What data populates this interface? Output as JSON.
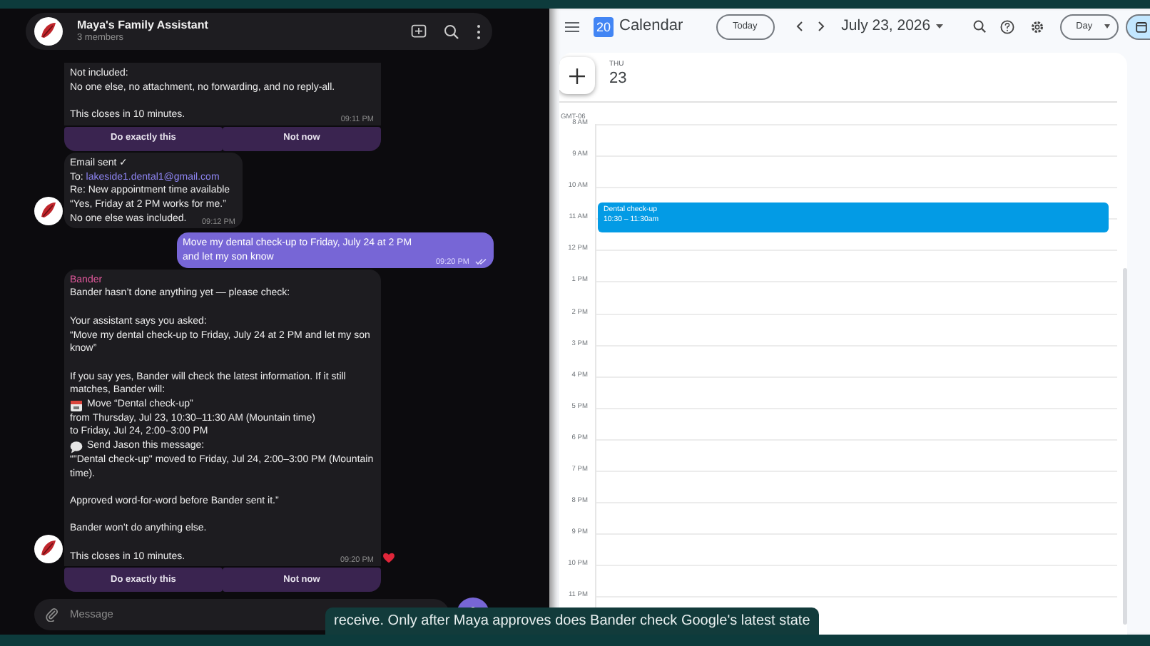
{
  "chat": {
    "title": "Maya's Family Assistant",
    "subtitle": "3 members",
    "messages": [
      {
        "kind": "bot",
        "avatar": false,
        "paragraphs": [
          [
            {
              "text": "Not included:"
            },
            {
              "text": "No one else, no attachment, no forwarding, and no reply-all."
            }
          ],
          [
            {
              "text": "This closes in 10 minutes."
            }
          ]
        ],
        "time": "09:11 PM",
        "buttons": [
          "Do exactly this",
          "Not now"
        ]
      },
      {
        "kind": "bot",
        "avatar": true,
        "paragraphs": [
          [
            {
              "text": "Email sent ✓"
            },
            {
              "text": "To:",
              "link": "lakeside1.dental1@gmail.com"
            },
            {
              "text": "Re: New appointment time available"
            },
            {
              "text": "“Yes, Friday at 2 PM works for me.”"
            },
            {
              "text": "No one else was included."
            }
          ]
        ],
        "time": "09:12 PM"
      },
      {
        "kind": "user",
        "paragraphs": [
          [
            {
              "text": "Move my dental check-up to Friday, July 24 at 2 PM and let my son know"
            }
          ]
        ],
        "time": "09:20 PM",
        "read": true
      },
      {
        "kind": "bot",
        "avatar": true,
        "sender": "Bander",
        "paragraphs": [
          [
            {
              "text": "Bander hasn’t done anything yet — please check:"
            }
          ],
          [
            {
              "text": "Your assistant says you asked:"
            },
            {
              "text": "“Move my dental check-up to Friday, July 24 at 2 PM and let my son know”"
            }
          ],
          [
            {
              "text": "If you say yes, Bander will check the latest information. If it still matches, Bander will:"
            },
            {
              "text": "Move “Dental check-up”",
              "kind": "calendar_item"
            },
            {
              "text": "from Thursday, Jul 23, 10:30–11:30 AM (Mountain time)"
            },
            {
              "text": "to Friday, Jul 24, 2:00–3:00 PM"
            },
            {
              "text": "Send Jason this message:",
              "kind": "message_item"
            },
            {
              "text": "“\"Dental check-up\" moved to Friday, Jul 24, 2:00–3:00 PM (Mountain time)."
            }
          ],
          [
            {
              "text": "Approved word-for-word before Bander sent it.”"
            }
          ],
          [
            {
              "text": "Bander won’t do anything else."
            }
          ],
          [
            {
              "text": "This closes in 10 minutes."
            }
          ]
        ],
        "time": "09:20 PM",
        "reacted": true,
        "buttons": [
          "Do exactly this",
          "Not now"
        ]
      }
    ],
    "input": {
      "placeholder": "Message"
    }
  },
  "calendar": {
    "logo_day": "20",
    "title": "Calendar",
    "today_button": "Today",
    "date": "July 23, 2026",
    "view": "Day",
    "day": {
      "name": "THU",
      "number": "23"
    },
    "timezone": "GMT-06",
    "hours": [
      {
        "label": "8 AM"
      },
      {
        "label": "9 AM"
      },
      {
        "label": "10 AM",
        "events": [
          {
            "title": "Dental check-up",
            "time": "10:30 – 11:30am"
          }
        ]
      },
      {
        "label": "11 AM"
      },
      {
        "label": "12 PM"
      },
      {
        "label": "1 PM"
      },
      {
        "label": "2 PM"
      },
      {
        "label": "3 PM"
      },
      {
        "label": "4 PM"
      },
      {
        "label": "5 PM"
      },
      {
        "label": "6 PM"
      },
      {
        "label": "7 PM"
      },
      {
        "label": "8 PM"
      },
      {
        "label": "9 PM"
      },
      {
        "label": "10 PM"
      },
      {
        "label": "11 PM"
      }
    ]
  },
  "caption": {
    "text": "receive. Only after Maya approves does Bander check Google's latest state"
  }
}
